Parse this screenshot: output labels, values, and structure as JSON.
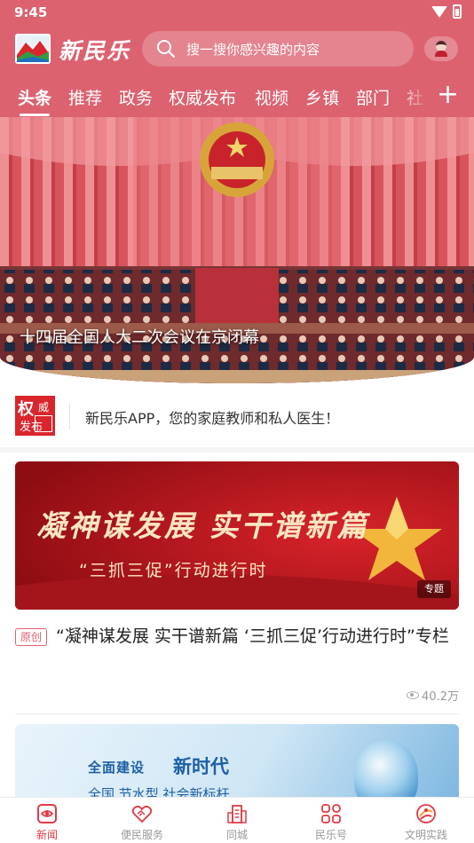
{
  "status_bar": {
    "time": "9:45"
  },
  "header": {
    "app_name": "新民乐",
    "search_placeholder": "搜一搜你感兴趣的内容",
    "tabs": [
      "头条",
      "推荐",
      "政务",
      "权威发布",
      "视频",
      "乡镇",
      "部门",
      "社"
    ],
    "active_tab": "头条",
    "add_tab_label": "+"
  },
  "hero": {
    "caption": "十四届全国人大二次会议在京闭幕"
  },
  "notice": {
    "badge_big": "权",
    "badge_small_1": "威",
    "badge_small_2": "发布",
    "text": "新民乐APP，您的家庭教师和私人医生！"
  },
  "feature": {
    "banner_title": "凝神谋发展  实干谱新篇",
    "banner_subtitle": "“三抓三促”行动进行时",
    "tag": "专题",
    "badge": "原创",
    "title": "“凝神谋发展  实干谱新篇  ‘三抓三促’行动进行时”专栏",
    "views": "40.2万"
  },
  "card2": {
    "line1_a": "全面建设",
    "line1_b": "新时代",
    "line2": "全国 节水型 社会新标杆"
  },
  "bottom_nav": [
    {
      "label": "新闻",
      "icon": "news-icon",
      "active": true
    },
    {
      "label": "便民服务",
      "icon": "handshake-icon",
      "active": false
    },
    {
      "label": "同城",
      "icon": "city-building-icon",
      "active": false
    },
    {
      "label": "民乐号",
      "icon": "apps-grid-icon",
      "active": false
    },
    {
      "label": "文明实践",
      "icon": "civilization-practice-icon",
      "active": false
    }
  ],
  "colors": {
    "header_red": "#dc6270",
    "accent_red": "#e03a44",
    "banner_red": "#b0141b"
  }
}
